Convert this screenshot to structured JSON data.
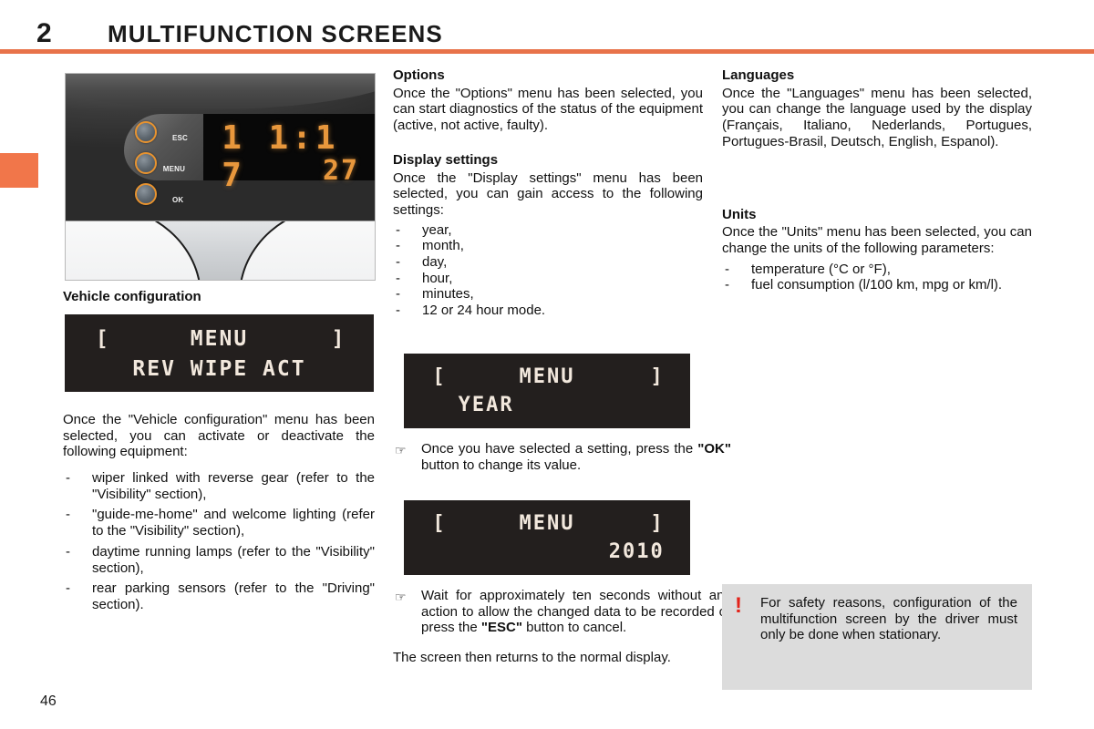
{
  "header": {
    "chapter_number": "2",
    "title": "MULTIFUNCTION SCREENS"
  },
  "page_number": "46",
  "colors": {
    "accent_rule": "#e8734a",
    "edge_tab": "#f1764a",
    "warning_icon": "#e32219",
    "lcd_background": "#231f1e",
    "lcd_text": "#f2e8dd",
    "cluster_segment": "#e8973c"
  },
  "dashboard_photo": {
    "buttons": [
      {
        "label": "ESC"
      },
      {
        "label": "MENU"
      },
      {
        "label": "OK"
      }
    ],
    "display_time": "1 1:1 7",
    "display_temperature": "27"
  },
  "left_column": {
    "caption": "Vehicle configuration",
    "lcd": {
      "bracket_left": "[",
      "menu_label": "MENU",
      "bracket_right": "]",
      "line2": "REV WIPE ACT"
    },
    "intro": "Once the \"Vehicle configuration\" menu has been selected, you can activate or deactivate the following equipment:",
    "items": [
      "wiper linked with reverse gear (refer to the \"Visibility\" section),",
      "\"guide-me-home\" and welcome lighting (refer to the \"Visibility\" section),",
      "daytime running lamps (refer to the \"Visibility\" section),",
      "rear parking sensors (refer to the \"Driving\" section)."
    ],
    "dash": "-"
  },
  "middle_column": {
    "options_heading": "Options",
    "options_text": "Once the \"Options\" menu has been selected, you can start diagnostics of the status of the equipment (active, not active, faulty).",
    "display_heading": "Display settings",
    "display_text": "Once the \"Display settings\" menu has been selected, you can gain access to the following settings:",
    "display_items": [
      "year,",
      "month,",
      "day,",
      "hour,",
      "minutes,",
      "12 or 24 hour mode."
    ],
    "dash": "-",
    "lcd_year": {
      "bracket_left": "[",
      "menu_label": "MENU",
      "bracket_right": "]",
      "line2": "YEAR"
    },
    "hand_icon": "☞",
    "tip_ok_part1": "Once you have selected a setting, press the ",
    "tip_ok_bold": "\"OK\"",
    "tip_ok_part2": " button to change its value.",
    "lcd_2010": {
      "bracket_left": "[",
      "menu_label": "MENU",
      "bracket_right": "]",
      "line2": "2010"
    },
    "tip_esc_part1": "Wait for approximately ten seconds without any action to allow the changed data to be recorded or press the ",
    "tip_esc_bold": "\"ESC\"",
    "tip_esc_part2": " button to cancel.",
    "closing_text": "The screen then returns to the normal display."
  },
  "right_column": {
    "languages_heading": "Languages",
    "languages_text": "Once the \"Languages\" menu has been selected, you can change the language used by the display (Français, Italiano, Nederlands, Portugues, Portugues-Brasil, Deutsch, English, Espanol).",
    "units_heading": "Units",
    "units_text": "Once the \"Units\" menu has been selected, you can change the units of the following parameters:",
    "units_items": [
      "temperature (°C or °F),",
      "fuel consumption (l/100 km, mpg or km/l)."
    ],
    "dash": "-",
    "warning": {
      "icon": "!",
      "text": "For safety reasons, configuration of the multifunction screen by the driver must only be done when stationary."
    }
  }
}
